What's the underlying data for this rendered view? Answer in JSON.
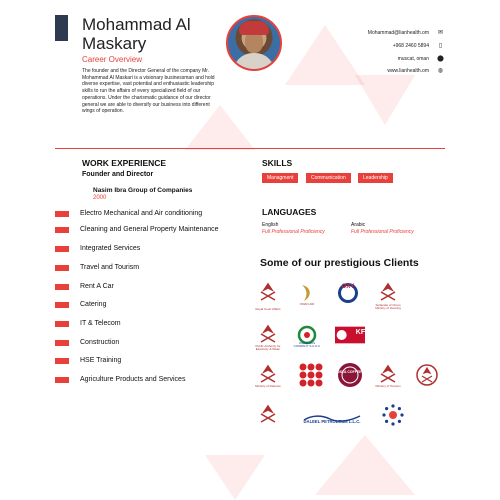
{
  "header": {
    "name": "Mohammad Al Maskary",
    "subtitle": "Career Overview",
    "bio": "The founder and the Director General of the company Mr. Mohammad Al Maskari is a visionary businessman and hold diverse expertise, vast potential and enthusiastic leadership skills to run the affairs of every specialized field of our operations. Under the charismatic guidance of our director general we are able to diversify our business into different wings of operation."
  },
  "contact": {
    "email": "Mohammad@lianhealth.om",
    "phone": "+968 2460 5894",
    "location": "muscat, oman",
    "website": "www.lianhealth.om"
  },
  "icons": {
    "email": "envelope-icon",
    "phone": "phone-icon",
    "location": "map-pin-icon",
    "website": "globe-icon"
  },
  "work": {
    "heading": "WORK EXPERIENCE",
    "role": "Founder and Director",
    "company": "Nasim Ibra Group of Companies",
    "year": "2000",
    "services": [
      "Electro Mechanical and Air conditioning",
      "Cleaning and General Property Maintenance",
      "Integrated Services",
      "Travel and Tourism",
      "Rent A Car",
      "Catering",
      "IT & Telecom",
      "Construction",
      "HSE Training",
      "Agriculture Products and Services"
    ]
  },
  "skills": {
    "heading": "SKILLS",
    "items": [
      "Managment",
      "Communication",
      "Leadership"
    ]
  },
  "languages": {
    "heading": "LANGUAGES",
    "items": [
      {
        "name": "English",
        "level": "Full Professional Proficiency"
      },
      {
        "name": "Arabic",
        "level": "Full Professional Proficiency"
      }
    ]
  },
  "clients": {
    "heading": "Some of our prestigious Clients",
    "logos": [
      {
        "text": "Royal Court Affairs"
      },
      {
        "text": "OMAN AIR"
      },
      {
        "text": "OXY"
      },
      {
        "text": "Sultanate of Oman Ministry of Housing"
      },
      {
        "text": "Public Authority for Electricity & Water"
      },
      {
        "text": "OMAN GAS COMPANY S.A.O.C"
      },
      {
        "text": "KFC"
      },
      {
        "text": "Ministry of Defence"
      },
      {
        "text": "COSTA COFFEE"
      },
      {
        "text": "Ministry of Tourism"
      },
      {
        "text": "Ministry of Health"
      },
      {
        "text": "DALEEL PETROLEUM L.L.C."
      },
      {
        "text": "PDO"
      }
    ]
  },
  "colors": {
    "accent": "#e8413b",
    "dark": "#2d3a4f"
  }
}
